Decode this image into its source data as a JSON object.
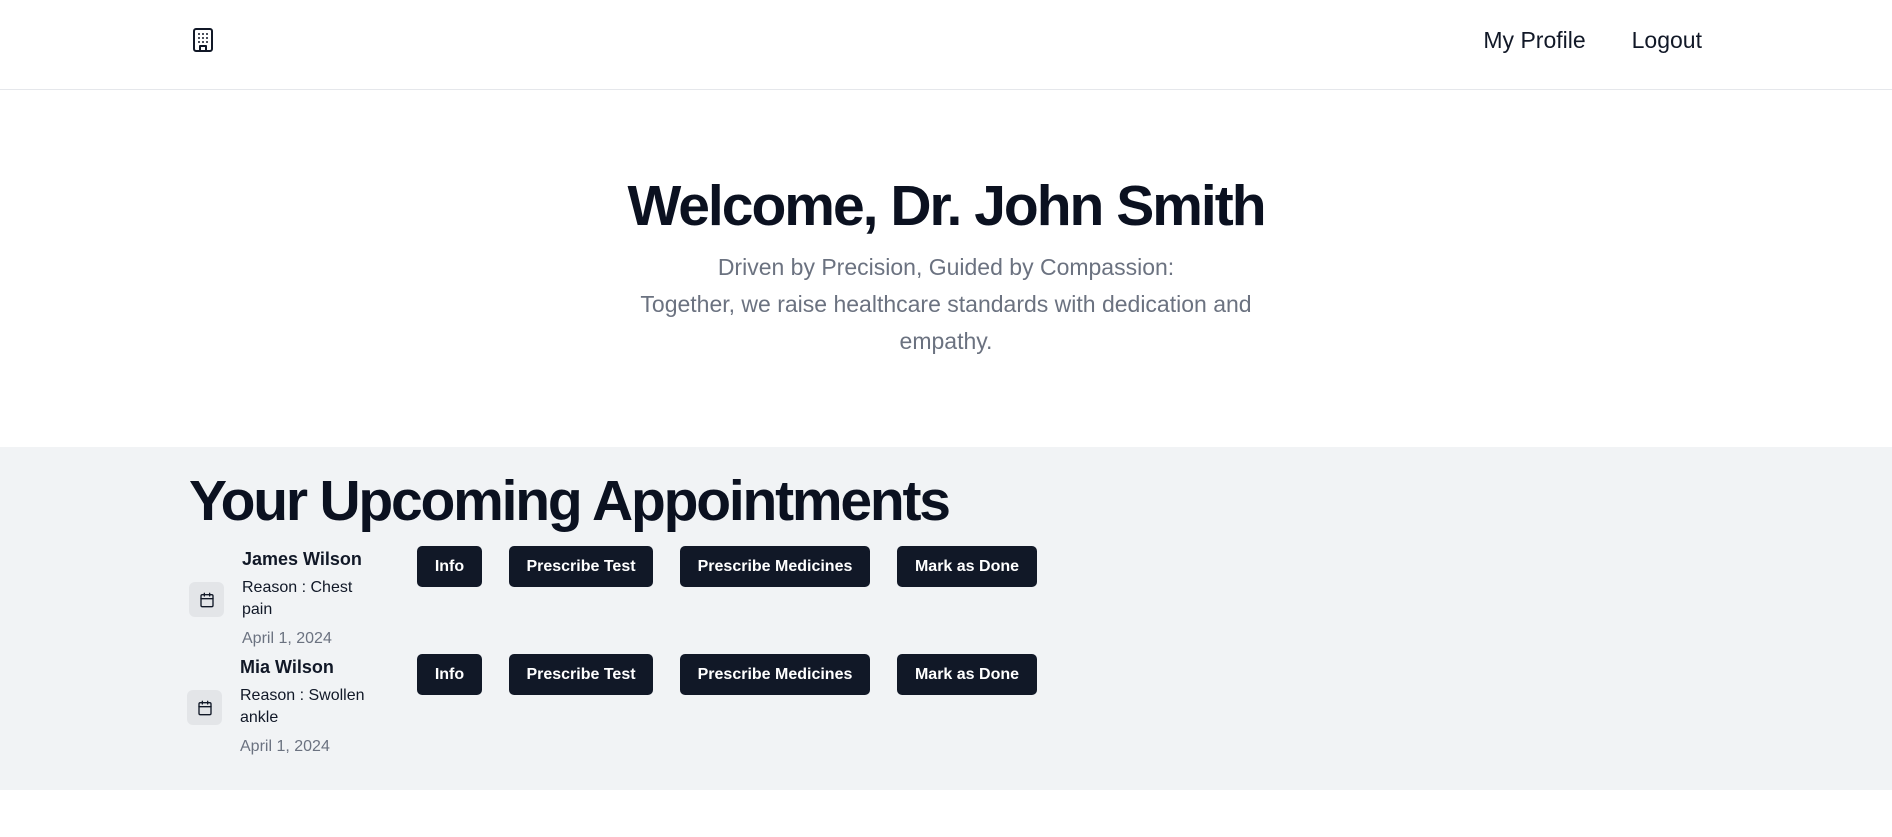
{
  "header": {
    "logo_icon": "building-icon",
    "nav": {
      "my_profile": "My Profile",
      "logout": "Logout"
    }
  },
  "hero": {
    "title": "Welcome, Dr. John Smith",
    "tagline_line1": "Driven by Precision, Guided by Compassion:",
    "tagline_line2": "Together, we raise healthcare standards with dedication and empathy."
  },
  "appointments": {
    "heading": "Your Upcoming Appointments",
    "calendar_icon": "calendar-icon",
    "items": [
      {
        "name": "James Wilson",
        "reason": "Reason : Chest pain",
        "date": "April 1, 2024",
        "buttons": {
          "info": "Info",
          "prescribe_test": "Prescribe Test",
          "prescribe_medicines": "Prescribe Medicines",
          "mark_done": "Mark as Done"
        }
      },
      {
        "name": "Mia Wilson",
        "reason": "Reason : Swollen ankle",
        "date": "April 1, 2024",
        "buttons": {
          "info": "Info",
          "prescribe_test": "Prescribe Test",
          "prescribe_medicines": "Prescribe Medicines",
          "mark_done": "Mark as Done"
        }
      }
    ]
  },
  "colors": {
    "primary_dark": "#111827",
    "muted_text": "#6b7280",
    "section_bg": "#f1f3f5"
  }
}
